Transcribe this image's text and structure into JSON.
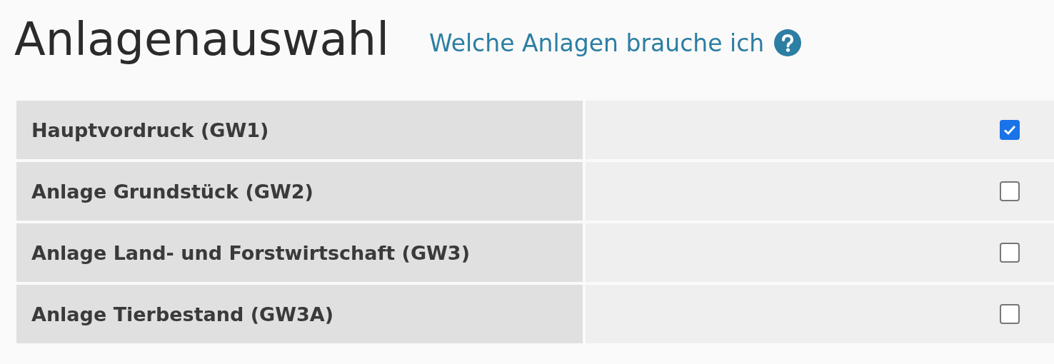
{
  "title": "Anlagenauswahl",
  "help_link": {
    "label": "Welche Anlagen brauche ich"
  },
  "rows": [
    {
      "label": "Hauptvordruck (GW1)",
      "checked": true
    },
    {
      "label": "Anlage Grundstück (GW2)",
      "checked": false
    },
    {
      "label": "Anlage Land- und Forstwirtschaft (GW3)",
      "checked": false
    },
    {
      "label": "Anlage Tierbestand (GW3A)",
      "checked": false
    }
  ]
}
